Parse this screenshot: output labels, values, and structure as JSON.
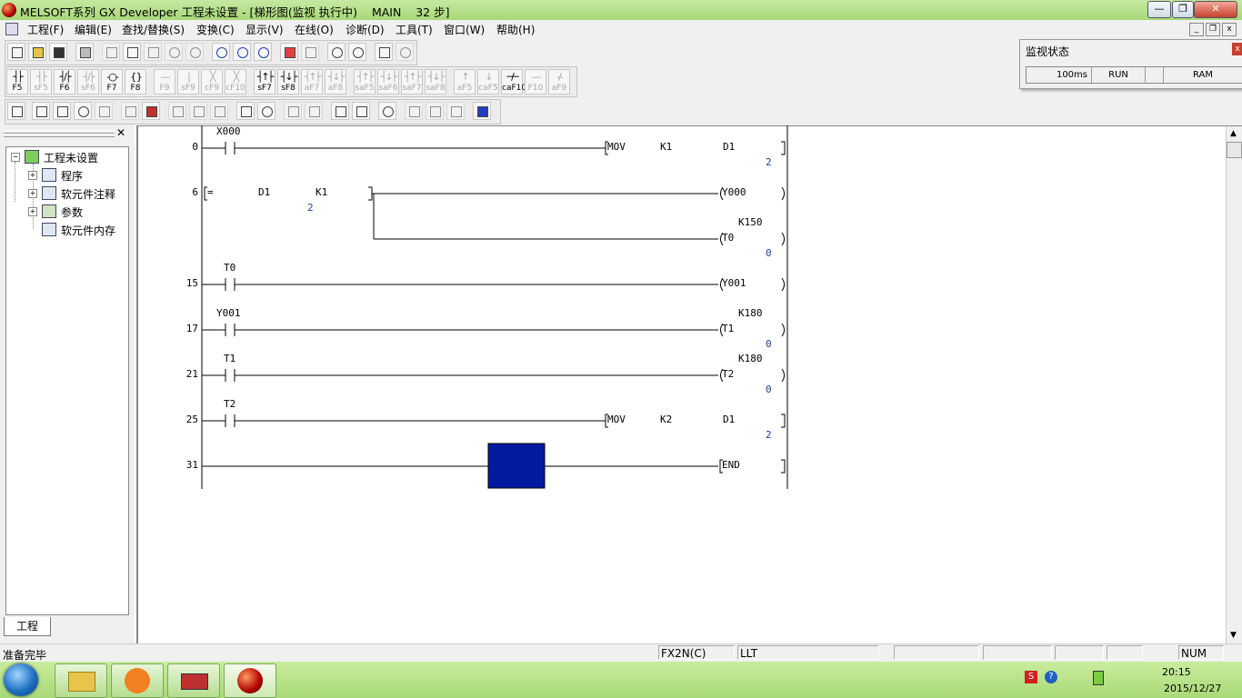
{
  "window": {
    "title": "MELSOFT系列 GX Developer 工程未设置 - [梯形图(监视 执行中)    MAIN    32 步]",
    "btn_min": "—",
    "btn_max": "❐",
    "btn_close": "✕"
  },
  "menu": {
    "items": [
      "工程(F)",
      "编辑(E)",
      "查找/替换(S)",
      "变换(C)",
      "显示(V)",
      "在线(O)",
      "诊断(D)",
      "工具(T)",
      "窗口(W)",
      "帮助(H)"
    ],
    "mdi_min": "_",
    "mdi_restore": "❐",
    "mdi_close": "x"
  },
  "function_keys": [
    {
      "sym": "┤├",
      "label": "F5",
      "enabled": true
    },
    {
      "sym": "┤├",
      "label": "sF5",
      "enabled": false
    },
    {
      "sym": "┤/├",
      "label": "F6",
      "enabled": true
    },
    {
      "sym": "┤/├",
      "label": "sF6",
      "enabled": false
    },
    {
      "sym": "-○-",
      "label": "F7",
      "enabled": true
    },
    {
      "sym": "{ }",
      "label": "F8",
      "enabled": true
    },
    {
      "sym": "—",
      "label": "F9",
      "enabled": false
    },
    {
      "sym": "|",
      "label": "sF9",
      "enabled": false
    },
    {
      "sym": "╳",
      "label": "cF9",
      "enabled": false
    },
    {
      "sym": "╳",
      "label": "cF10",
      "enabled": false
    },
    {
      "sym": "┤↑├",
      "label": "sF7",
      "enabled": true
    },
    {
      "sym": "┤↓├",
      "label": "sF8",
      "enabled": true
    },
    {
      "sym": "┤↑├",
      "label": "aF7",
      "enabled": false
    },
    {
      "sym": "┤↓├",
      "label": "aF8",
      "enabled": false
    },
    {
      "sym": "┤↑├",
      "label": "saF5",
      "enabled": false
    },
    {
      "sym": "┤↓├",
      "label": "saF6",
      "enabled": false
    },
    {
      "sym": "┤↑├",
      "label": "saF7",
      "enabled": false
    },
    {
      "sym": "┤↓├",
      "label": "saF8",
      "enabled": false
    },
    {
      "sym": "↑",
      "label": "aF5",
      "enabled": false
    },
    {
      "sym": "↓",
      "label": "caF5",
      "enabled": false
    },
    {
      "sym": "─/─",
      "label": "caF10",
      "enabled": true
    },
    {
      "sym": "—",
      "label": "F10",
      "enabled": false
    },
    {
      "sym": "-/-",
      "label": "aF9",
      "enabled": false
    }
  ],
  "monitor": {
    "title": "监视状态",
    "close": "x",
    "scan_time": "100ms",
    "cpu_status": "RUN",
    "memory": "RAM"
  },
  "project": {
    "panel_close": "✕",
    "root": "工程未设置",
    "items": [
      "程序",
      "软元件注释",
      "参数",
      "软元件内存"
    ],
    "tab": "工程"
  },
  "ladder": {
    "rungs": [
      {
        "step": "0",
        "contact": "X000",
        "inst": "MOV",
        "op1": "K1",
        "op2": "D1",
        "monitor": "2"
      },
      {
        "step": "6",
        "cmp": "=",
        "op1": "D1",
        "op2": "K1",
        "op1_value": "2",
        "coil1": "Y000",
        "coil2": "T0",
        "coil2_setting": "K150",
        "coil2_value": "0"
      },
      {
        "step": "15",
        "contact": "T0",
        "coil": "Y001"
      },
      {
        "step": "17",
        "contact": "Y001",
        "coil": "T1",
        "setting": "K180",
        "value": "0"
      },
      {
        "step": "21",
        "contact": "T1",
        "coil": "T2",
        "setting": "K180",
        "value": "0"
      },
      {
        "step": "25",
        "contact": "T2",
        "inst": "MOV",
        "op1": "K2",
        "op2": "D1",
        "monitor": "2"
      },
      {
        "step": "31",
        "end": "END"
      }
    ],
    "cursor_color": "#001aa0"
  },
  "statusbar": {
    "left": "准备完毕",
    "plc_type": "FX2N(C)",
    "mode": "LLT",
    "numlock": "NUM"
  },
  "taskbar": {
    "date": "2015/12/27",
    "time": "20:15"
  }
}
